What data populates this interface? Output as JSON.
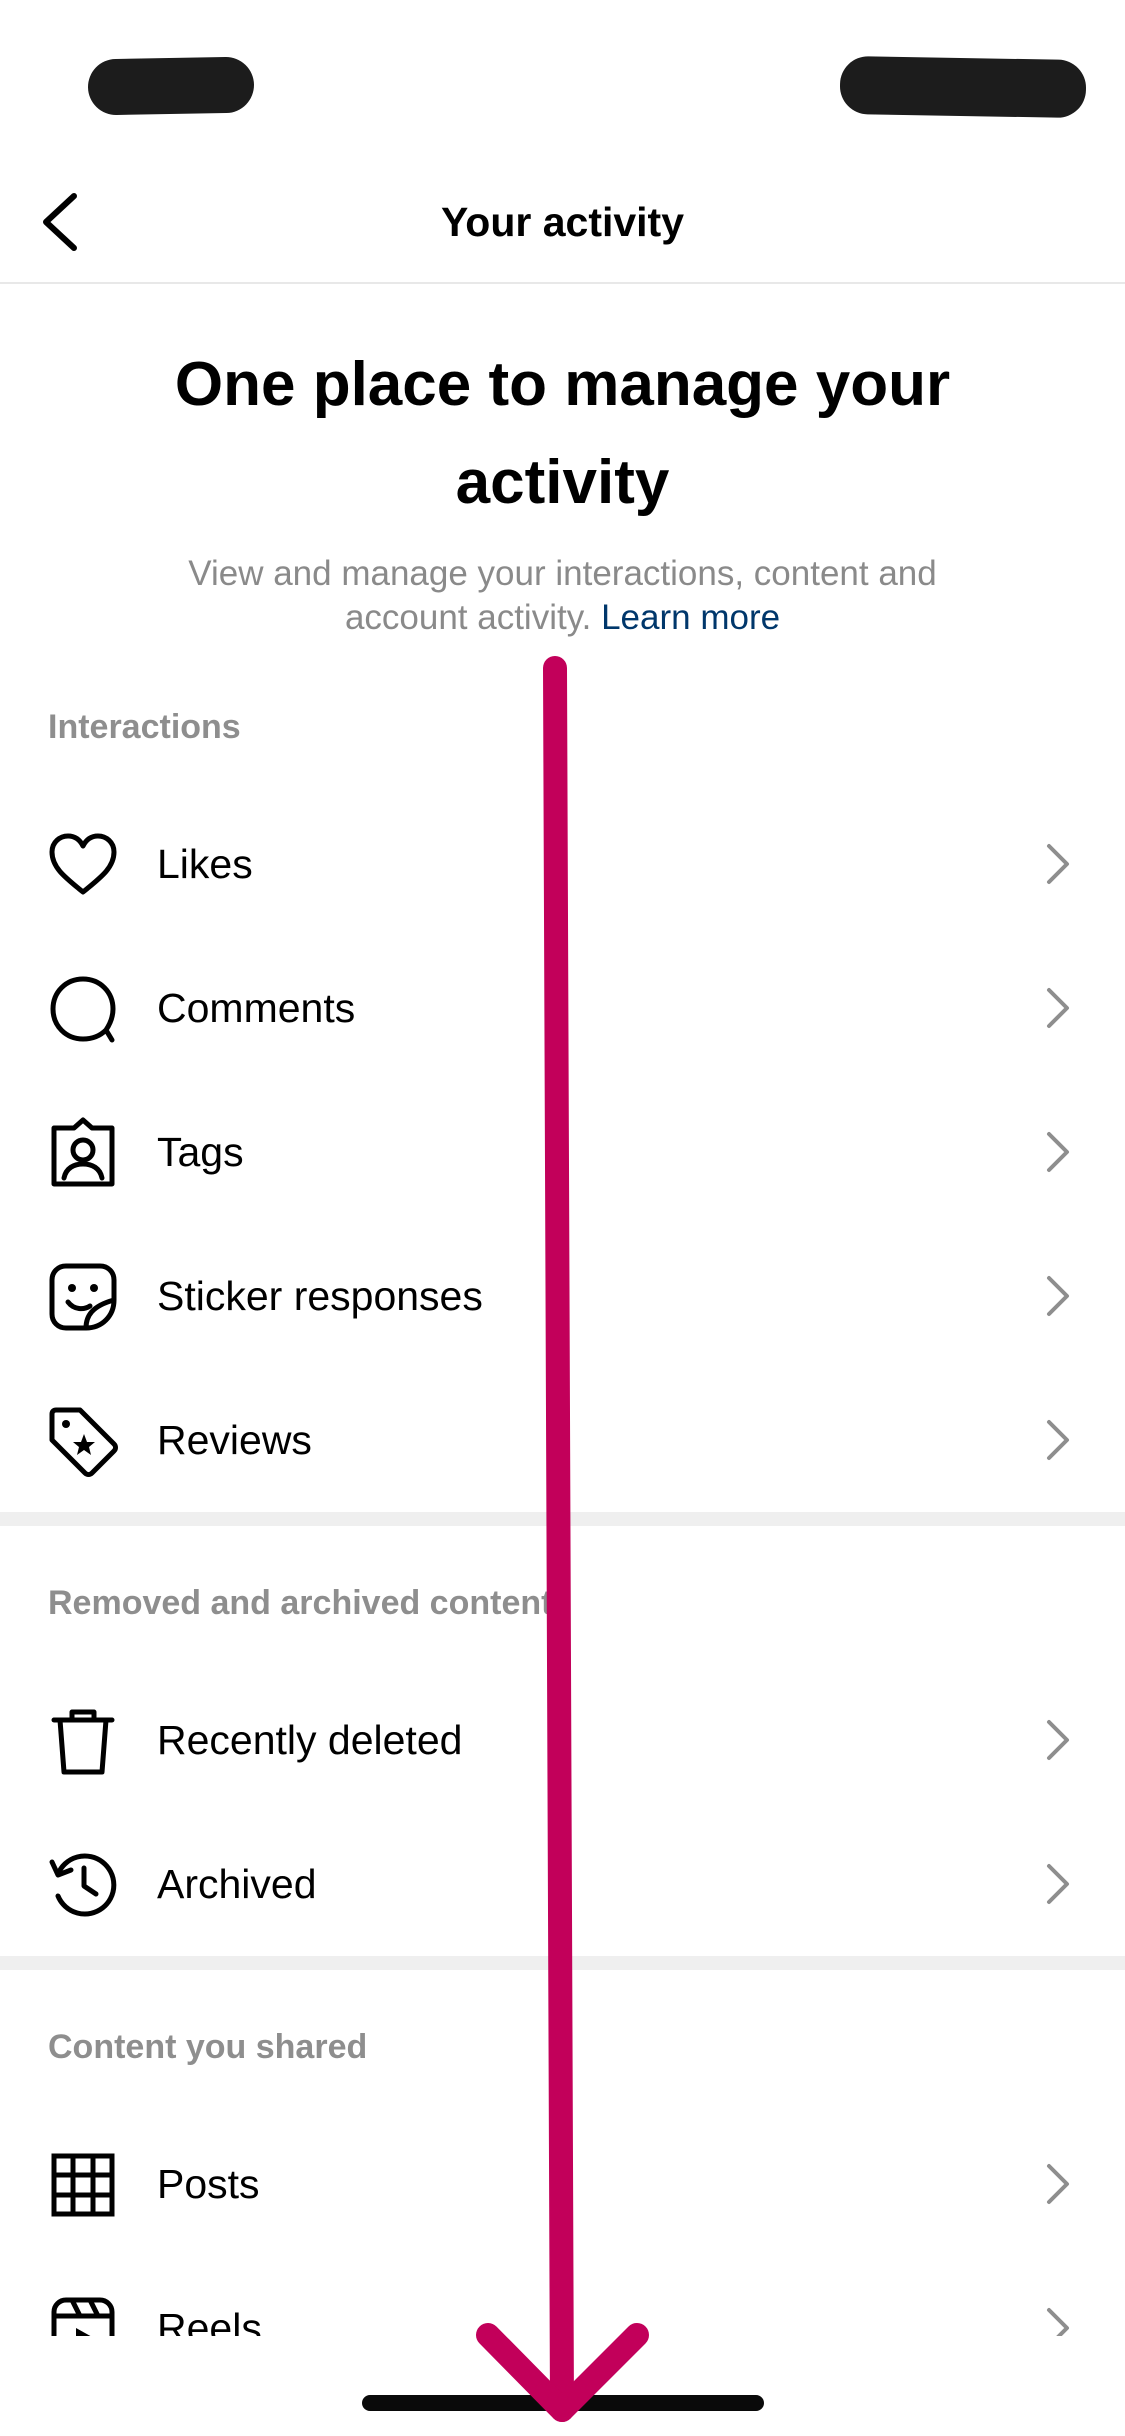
{
  "nav": {
    "title": "Your activity"
  },
  "hero": {
    "title": "One place to manage your activity",
    "description": "View and manage your interactions, content and account activity.",
    "learn_more": "Learn more"
  },
  "sections": {
    "interactions": {
      "header": "Interactions",
      "items": [
        {
          "label": "Likes",
          "icon": "heart-icon"
        },
        {
          "label": "Comments",
          "icon": "comment-bubble-icon"
        },
        {
          "label": "Tags",
          "icon": "tag-person-icon"
        },
        {
          "label": "Sticker responses",
          "icon": "sticker-icon"
        },
        {
          "label": "Reviews",
          "icon": "review-tag-icon"
        }
      ]
    },
    "removed": {
      "header": "Removed and archived content",
      "items": [
        {
          "label": "Recently deleted",
          "icon": "trash-icon"
        },
        {
          "label": "Archived",
          "icon": "archive-history-icon"
        }
      ]
    },
    "shared": {
      "header": "Content you shared",
      "items": [
        {
          "label": "Posts",
          "icon": "grid-icon"
        },
        {
          "label": "Reels",
          "icon": "reels-icon"
        }
      ]
    }
  },
  "overlay": {
    "gesture": "swipe-down-arrow",
    "color": "#c2005a"
  }
}
